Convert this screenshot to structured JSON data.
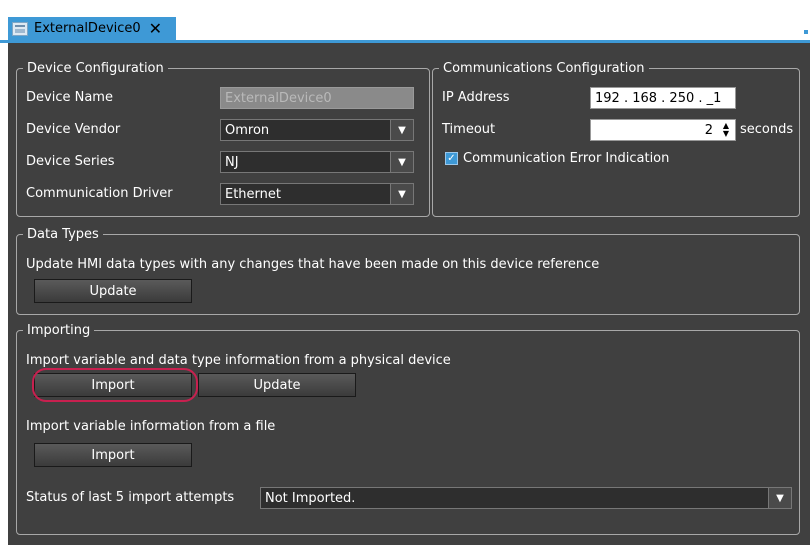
{
  "tab": {
    "title": "ExternalDevice0",
    "close_glyph": "✕",
    "icon": "device-icon"
  },
  "device_config": {
    "legend": "Device Configuration",
    "device_name_label": "Device Name",
    "device_name_value": "ExternalDevice0",
    "vendor_label": "Device Vendor",
    "vendor_value": "Omron",
    "series_label": "Device Series",
    "series_value": "NJ",
    "driver_label": "Communication Driver",
    "driver_value": "Ethernet"
  },
  "comm_config": {
    "legend": "Communications Configuration",
    "ip_label": "IP Address",
    "ip_value": "192 . 168 . 250 . _1",
    "timeout_label": "Timeout",
    "timeout_value": "2",
    "timeout_unit": "seconds",
    "error_indication_label": "Communication Error Indication",
    "error_indication_checked": true
  },
  "data_types": {
    "legend": "Data Types",
    "description": "Update HMI data types with any changes that have been made on this device reference",
    "update_label": "Update"
  },
  "importing": {
    "legend": "Importing",
    "physical_description": "Import variable and data type information from a physical device",
    "import_label": "Import",
    "update_label": "Update",
    "file_description": "Import variable information from a file",
    "file_import_label": "Import",
    "status_label": "Status of last 5 import attempts",
    "status_value": "Not Imported."
  },
  "colors": {
    "accent": "#3e99d6",
    "panel": "#404040",
    "highlight": "#c8204f"
  }
}
